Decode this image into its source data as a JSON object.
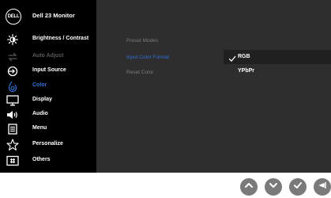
{
  "header": {
    "logo_text": "DELL",
    "title": "Dell 23 Monitor"
  },
  "sidebar": {
    "items": [
      {
        "label": "Brightness / Contrast",
        "icon": "brightness-icon",
        "state": "normal"
      },
      {
        "label": "Auto Adjust",
        "icon": "auto-adjust-icon",
        "state": "disabled"
      },
      {
        "label": "Input Source",
        "icon": "input-source-icon",
        "state": "normal"
      },
      {
        "label": "Color",
        "icon": "color-icon",
        "state": "selected"
      },
      {
        "label": "Display",
        "icon": "display-icon",
        "state": "normal"
      },
      {
        "label": "Audio",
        "icon": "audio-icon",
        "state": "normal"
      },
      {
        "label": "Menu",
        "icon": "menu-icon",
        "state": "normal"
      },
      {
        "label": "Personalize",
        "icon": "personalize-star-icon",
        "state": "normal"
      },
      {
        "label": "Others",
        "icon": "others-icon",
        "state": "normal"
      }
    ]
  },
  "panel": {
    "submenu": [
      {
        "label": "Preset Modes",
        "state": "normal"
      },
      {
        "label": "Input Color Format",
        "state": "active"
      },
      {
        "label": "Reset Color",
        "state": "normal"
      }
    ],
    "options": [
      {
        "label": "RGB",
        "selected": true
      },
      {
        "label": "YPbPr",
        "selected": false
      }
    ]
  },
  "buttons": [
    {
      "name": "up-button",
      "icon": "chevron-up-icon"
    },
    {
      "name": "down-button",
      "icon": "chevron-down-icon"
    },
    {
      "name": "ok-button",
      "icon": "checkmark-icon"
    },
    {
      "name": "back-button",
      "icon": "back-arrow-icon"
    }
  ],
  "colors": {
    "accent": "#2f6fd4",
    "sidebar_bg": "#000000",
    "panel_bg": "#2e2e2e",
    "button_bg": "#7a7a7a"
  }
}
